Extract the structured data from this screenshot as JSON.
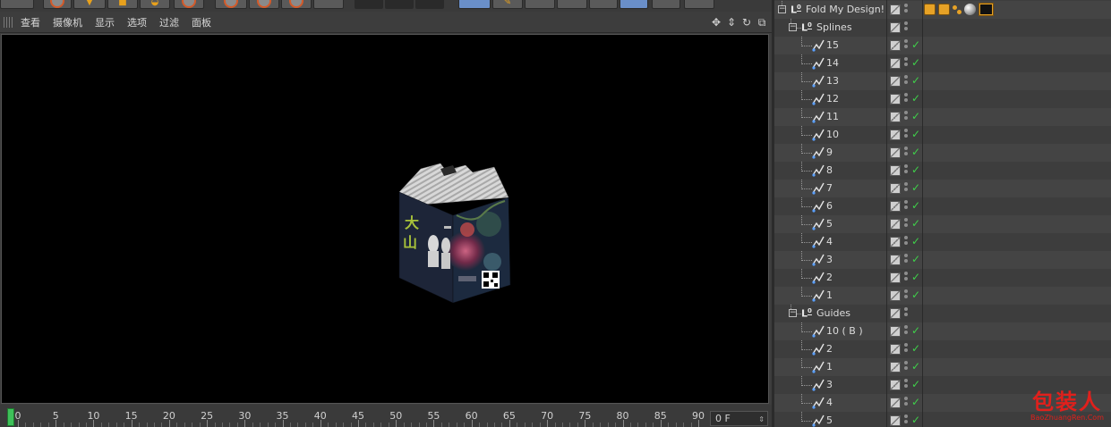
{
  "viewport": {
    "menu": [
      "查看",
      "摄像机",
      "显示",
      "选项",
      "过滤",
      "面板"
    ]
  },
  "timeline": {
    "ticks": [
      0,
      5,
      10,
      15,
      20,
      25,
      30,
      35,
      40,
      45,
      50,
      55,
      60,
      65,
      70,
      75,
      80,
      85,
      90
    ],
    "current_frame": "0 F"
  },
  "objects": [
    {
      "name": "Fold My Design!",
      "kind": "null",
      "level": 0,
      "expandable": true,
      "checked": false,
      "tags": true
    },
    {
      "name": "Splines",
      "kind": "null",
      "level": 1,
      "expandable": true,
      "checked": false
    },
    {
      "name": "15",
      "kind": "spline",
      "level": 2,
      "checked": true
    },
    {
      "name": "14",
      "kind": "spline",
      "level": 2,
      "checked": true
    },
    {
      "name": "13",
      "kind": "spline",
      "level": 2,
      "checked": true
    },
    {
      "name": "12",
      "kind": "spline",
      "level": 2,
      "checked": true
    },
    {
      "name": "11",
      "kind": "spline",
      "level": 2,
      "checked": true
    },
    {
      "name": "10",
      "kind": "spline",
      "level": 2,
      "checked": true
    },
    {
      "name": "9",
      "kind": "spline",
      "level": 2,
      "checked": true
    },
    {
      "name": "8",
      "kind": "spline",
      "level": 2,
      "checked": true
    },
    {
      "name": "7",
      "kind": "spline",
      "level": 2,
      "checked": true
    },
    {
      "name": "6",
      "kind": "spline",
      "level": 2,
      "checked": true
    },
    {
      "name": "5",
      "kind": "spline",
      "level": 2,
      "checked": true
    },
    {
      "name": "4",
      "kind": "spline",
      "level": 2,
      "checked": true
    },
    {
      "name": "3",
      "kind": "spline",
      "level": 2,
      "checked": true
    },
    {
      "name": "2",
      "kind": "spline",
      "level": 2,
      "checked": true
    },
    {
      "name": "1",
      "kind": "spline",
      "level": 2,
      "checked": true
    },
    {
      "name": "Guides",
      "kind": "null",
      "level": 1,
      "expandable": true,
      "checked": false
    },
    {
      "name": "10 ( B )",
      "kind": "spline",
      "level": 2,
      "checked": true
    },
    {
      "name": "2",
      "kind": "spline",
      "level": 2,
      "checked": true
    },
    {
      "name": "1",
      "kind": "spline",
      "level": 2,
      "checked": true
    },
    {
      "name": "3",
      "kind": "spline",
      "level": 2,
      "checked": true
    },
    {
      "name": "4",
      "kind": "spline",
      "level": 2,
      "checked": true
    },
    {
      "name": "5",
      "kind": "spline",
      "level": 2,
      "checked": true
    }
  ],
  "object_tags": [
    "material-tag-icon",
    "material-tag-icon",
    "points-tag-icon",
    "sphere-material-icon",
    "texture-tag-icon"
  ],
  "watermark": {
    "logo": "包装人",
    "url": "BaoZhuangRen.Com"
  },
  "colors": {
    "accent_green": "#3fd04a",
    "tag_orange": "#e7a226",
    "viewport_bg": "#000000",
    "watermark_red": "#e0201c"
  }
}
